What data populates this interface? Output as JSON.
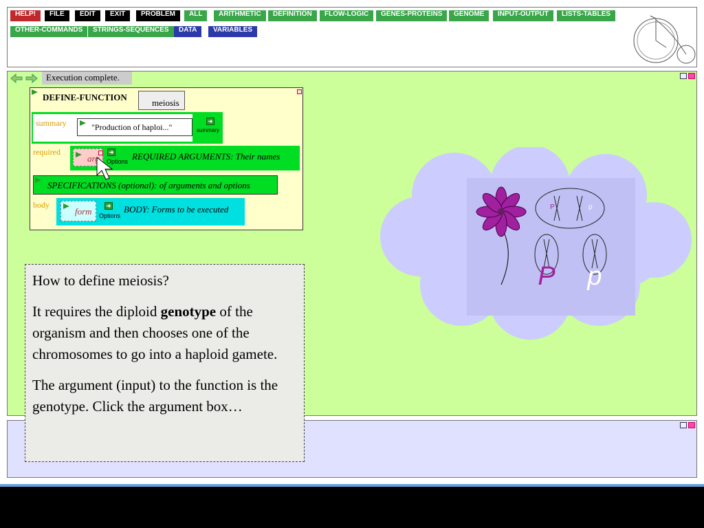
{
  "toolbar": {
    "buttons": [
      {
        "label": "HELP!",
        "color": "#c0282c"
      },
      {
        "label": "FILE",
        "color": "#000000"
      },
      {
        "label": "EDIT",
        "color": "#000000"
      },
      {
        "label": "EXIT",
        "color": "#000000"
      },
      {
        "label": "PROBLEM",
        "color": "#000000"
      },
      {
        "label": "ALL",
        "color": "#3aa64a"
      },
      {
        "label": "ARITHMETIC",
        "color": "#3aa64a"
      },
      {
        "label": "DEFINITION",
        "color": "#3aa64a"
      },
      {
        "label": "FLOW-LOGIC",
        "color": "#3aa64a"
      },
      {
        "label": "GENES-PROTEINS",
        "color": "#3aa64a"
      },
      {
        "label": "GENOME",
        "color": "#3aa64a"
      },
      {
        "label": "INPUT-OUTPUT",
        "color": "#3aa64a"
      },
      {
        "label": "LISTS-TABLES",
        "color": "#3aa64a"
      },
      {
        "label": "OTHER-COMMANDS",
        "color": "#3aa64a"
      },
      {
        "label": "STRINGS-SEQUENCES",
        "color": "#3aa64a"
      },
      {
        "label": "DATA",
        "color": "#2b3aa8"
      },
      {
        "label": "VARIABLES",
        "color": "#2b3aa8"
      }
    ]
  },
  "status": {
    "text": "Execution complete."
  },
  "define": {
    "title": "DEFINE-FUNCTION",
    "name": "meiosis",
    "summary_label": "summary",
    "summary_value": "\"Production of haploi...\"",
    "summary_tag": "summary",
    "required_label": "required",
    "arg": "arg",
    "options": "Options",
    "required_text": "REQUIRED ARGUMENTS: Their names",
    "spec_text": "SPECIFICATIONS (optional): of arguments and options",
    "body_label": "body",
    "form": "form",
    "body_text": "BODY: Forms to be executed"
  },
  "genetics": {
    "allele_dom": "P",
    "allele_rec": "p"
  },
  "note": {
    "p1": "How to define meiosis?",
    "p2_pre": "It requires the diploid ",
    "p2_bold": "genotype",
    "p2_post": " of the organism and then chooses one of the chromosomes to go into a haploid gamete.",
    "p3": "The argument (input) to the function is the genotype. Click the argument box…"
  }
}
